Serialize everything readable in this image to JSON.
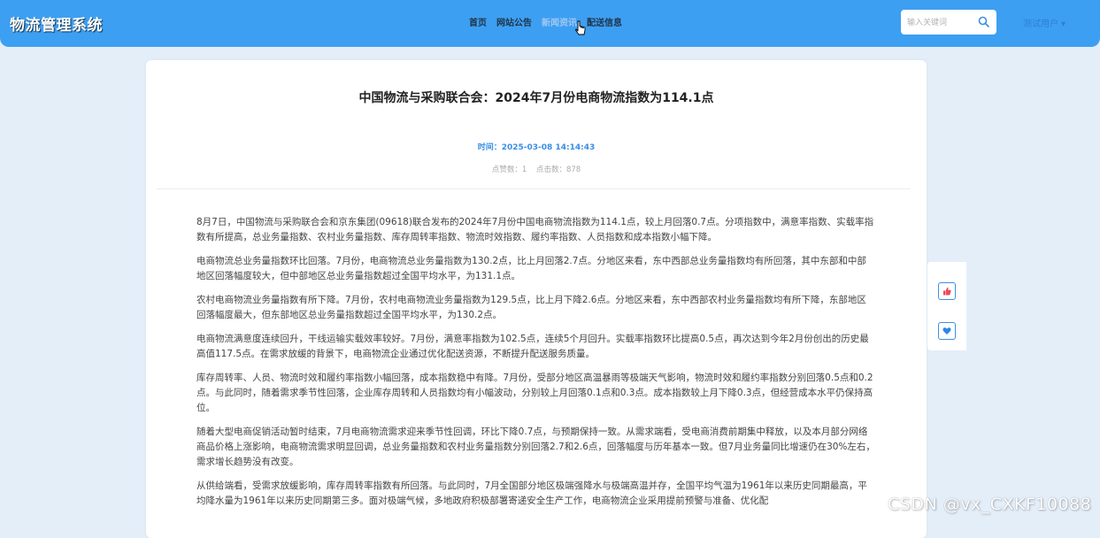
{
  "header": {
    "brand": "物流管理系统",
    "nav": [
      "首页",
      "网站公告",
      "新闻资讯",
      "配送信息"
    ],
    "active_nav": "新闻资讯",
    "search_placeholder": "输入关键词",
    "user": "测试用户 ▾"
  },
  "article": {
    "title": "中国物流与采购联合会：2024年7月份电商物流指数为114.1点",
    "time": "时间：2025-03-08 14:14:43",
    "likes": "点赞数：1",
    "clicks": "点击数：878",
    "paragraphs": [
      "8月7日，中国物流与采购联合会和京东集团(09618)联合发布的2024年7月份中国电商物流指数为114.1点，较上月回落0.7点。分项指数中，满意率指数、实载率指数有所提高，总业务量指数、农村业务量指数、库存周转率指数、物流时效指数、履约率指数、人员指数和成本指数小幅下降。",
      "电商物流总业务量指数环比回落。7月份，电商物流总业务量指数为130.2点，比上月回落2.7点。分地区来看，东中西部总业务量指数均有所回落，其中东部和中部地区回落幅度较大，但中部地区总业务量指数超过全国平均水平，为131.1点。",
      "农村电商物流业务量指数有所下降。7月份，农村电商物流业务量指数为129.5点，比上月下降2.6点。分地区来看，东中西部农村业务量指数均有所下降，东部地区回落幅度最大，但东部地区总业务量指数超过全国平均水平，为130.2点。",
      "电商物流满意度连续回升，干线运输实载效率较好。7月份，满意率指数为102.5点，连续5个月回升。实载率指数环比提高0.5点，再次达到今年2月份创出的历史最高值117.5点。在需求放缓的背景下，电商物流企业通过优化配送资源，不断提升配送服务质量。",
      "库存周转率、人员、物流时效和履约率指数小幅回落，成本指数稳中有降。7月份，受部分地区高温暴雨等极端天气影响，物流时效和履约率指数分别回落0.5点和0.2点。与此同时，随着需求季节性回落，企业库存周转和人员指数均有小幅波动，分别较上月回落0.1点和0.3点。成本指数较上月下降0.3点，但经营成本水平仍保持高位。",
      "随着大型电商促销活动暂时结束，7月电商物流需求迎来季节性回调，环比下降0.7点，与预期保持一致。从需求端看，受电商消费前期集中释放，以及本月部分网络商品价格上涨影响，电商物流需求明显回调，总业务量指数和农村业务量指数分别回落2.7和2.6点，回落幅度与历年基本一致。但7月业务量同比增速仍在30%左右，需求增长趋势没有改变。",
      "从供给端看，受需求放缓影响，库存周转率指数有所回落。与此同时，7月全国部分地区极端强降水与极端高温并存，全国平均气温为1961年以来历史同期最高，平均降水量为1961年以来历史同期第三多。面对极端气候，多地政府积极部署寄递安全生产工作，电商物流企业采用提前预警与准备、优化配"
    ]
  },
  "watermark": "CSDN @vx_CXKF10088",
  "colors": {
    "header": "#3d9ff1",
    "accent": "#3a8ee6",
    "background": "#e3eef9"
  },
  "icons": [
    "search-icon",
    "mouse-pointer-icon",
    "thumbs-up-icon",
    "heart-icon"
  ]
}
